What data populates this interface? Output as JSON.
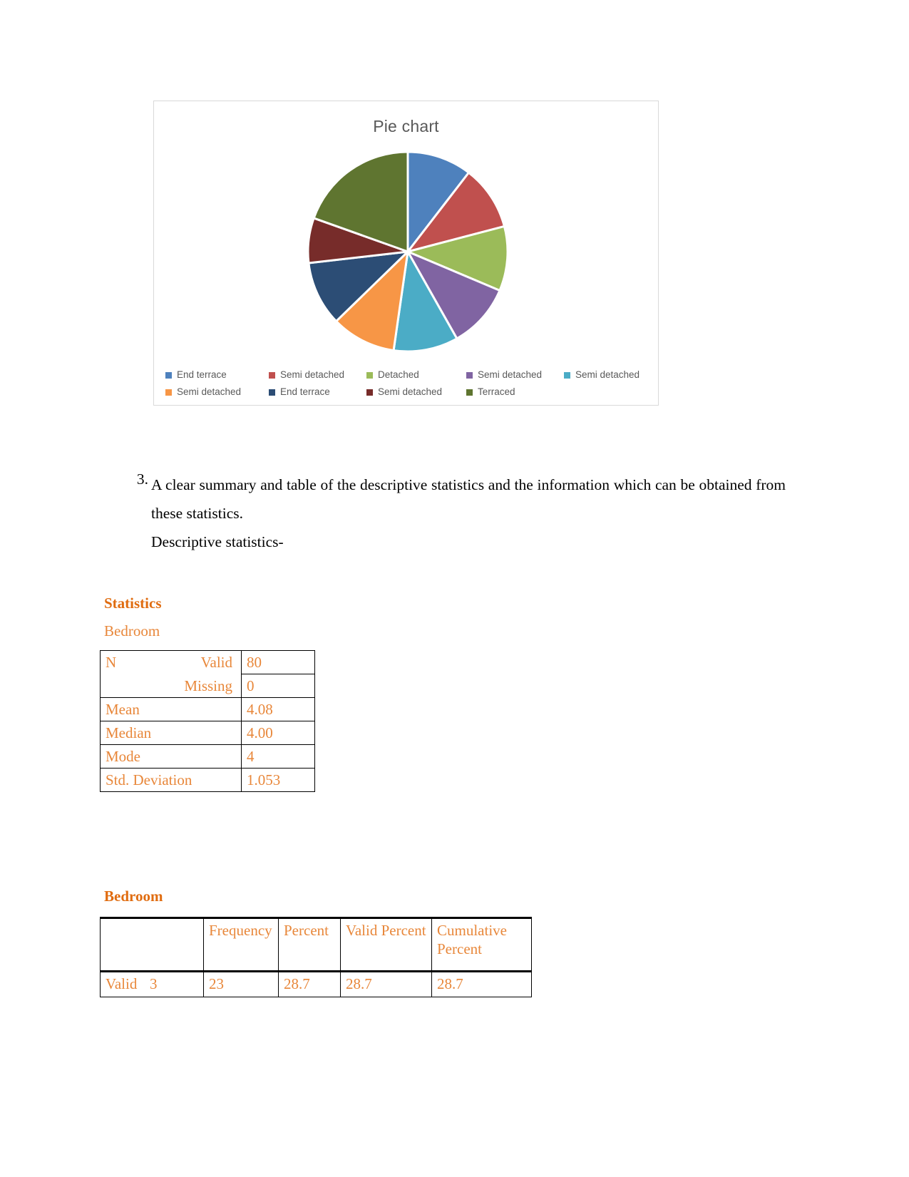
{
  "chart": {
    "title": "Pie chart",
    "legend": [
      [
        {
          "label": "End terrace",
          "color": "#4E81BD"
        },
        {
          "label": "Semi detached",
          "color": "#C0504E"
        },
        {
          "label": "Detached",
          "color": "#9BBB59"
        },
        {
          "label": "Semi detached",
          "color": "#8064A2"
        },
        {
          "label": "Semi detached",
          "color": "#4BACC6"
        }
      ],
      [
        {
          "label": "Semi detached",
          "color": "#F79646"
        },
        {
          "label": "End terrace",
          "color": "#2C4D75"
        },
        {
          "label": "Semi detached",
          "color": "#772C2A"
        },
        {
          "label": "Terraced",
          "color": "#5F7530"
        }
      ]
    ]
  },
  "chart_data": {
    "type": "pie",
    "title": "Pie chart",
    "legend_position": "bottom",
    "labels": [
      "End terrace",
      "Semi detached",
      "Detached",
      "Semi detached",
      "Semi detached",
      "Semi detached",
      "End terrace",
      "Semi detached",
      "Terraced"
    ],
    "colors": [
      "#4E81BD",
      "#C0504E",
      "#9BBB59",
      "#8064A2",
      "#4BACC6",
      "#F79646",
      "#2C4D75",
      "#772C2A",
      "#5F7530"
    ],
    "values": [
      11.5,
      11.5,
      11.5,
      11.5,
      11.5,
      11.5,
      11.5,
      8.0,
      21.5
    ],
    "start_angle_deg": 0,
    "units": "percent"
  },
  "body": {
    "item_number": "3.",
    "item_text": "A clear summary and table of the descriptive statistics and the information which can be obtained from these statistics.",
    "subline": "Descriptive statistics-"
  },
  "statistics_table": {
    "title": "Statistics",
    "subtitle": "Bedroom",
    "rows": [
      {
        "label": "N",
        "sub": "Valid",
        "value": "80"
      },
      {
        "label": "",
        "sub": "Missing",
        "value": "0"
      },
      {
        "label": "Mean",
        "sub": "",
        "value": "4.08"
      },
      {
        "label": "Median",
        "sub": "",
        "value": "4.00"
      },
      {
        "label": "Mode",
        "sub": "",
        "value": "4"
      },
      {
        "label": "Std. Deviation",
        "sub": "",
        "value": "1.053"
      }
    ]
  },
  "frequency_table": {
    "title": "Bedroom",
    "headers": [
      "",
      "Frequency",
      "Percent",
      "Valid Percent",
      "Cumulative Percent"
    ],
    "rows": [
      {
        "group": "Valid",
        "category": "3",
        "frequency": "23",
        "percent": "28.7",
        "valid_percent": "28.7",
        "cumulative_percent": "28.7"
      }
    ]
  }
}
